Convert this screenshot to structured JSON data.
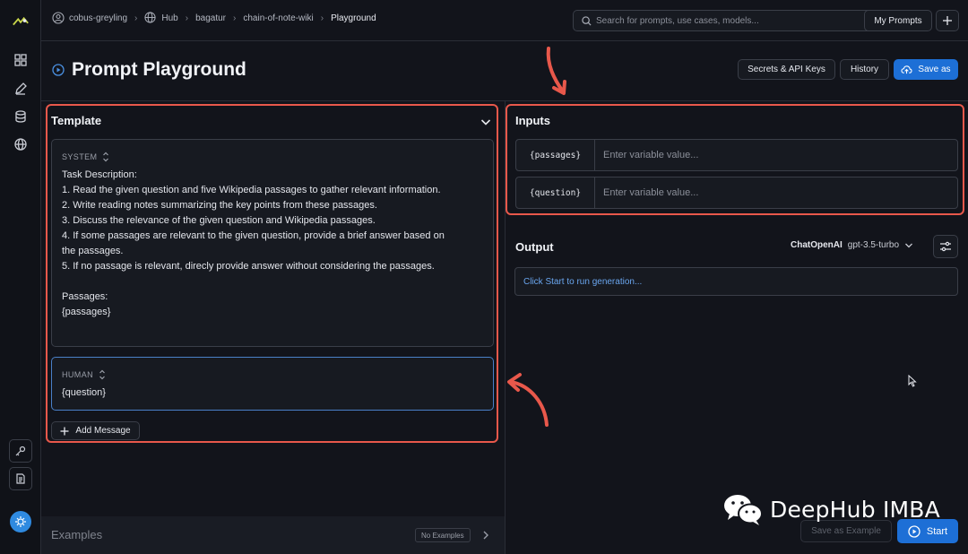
{
  "breadcrumbs": {
    "user": "cobus-greyling",
    "hub": "Hub",
    "owner": "bagatur",
    "repo": "chain-of-note-wiki",
    "current": "Playground"
  },
  "search": {
    "placeholder": "Search for prompts, use cases, models..."
  },
  "top_actions": {
    "my_prompts": "My Prompts"
  },
  "page": {
    "title": "Prompt Playground"
  },
  "header_actions": {
    "secrets": "Secrets & API Keys",
    "history": "History",
    "save_as": "Save as"
  },
  "template": {
    "title": "Template",
    "messages": [
      {
        "role": "SYSTEM",
        "text": "Task Description:\n1. Read the given question and five Wikipedia passages to gather relevant information.\n2. Write reading notes summarizing the key points from these passages.\n3. Discuss the relevance of the given question and Wikipedia passages.\n4. If some passages are relevant to the given question, provide a brief answer based on\nthe passages.\n5. If no passage is relevant, direcly provide answer without considering the passages.\n\nPassages:\n{passages}"
      },
      {
        "role": "HUMAN",
        "text": "{question}"
      }
    ],
    "add_message": "Add Message"
  },
  "inputs": {
    "title": "Inputs",
    "variables": [
      {
        "name": "{passages}",
        "placeholder": "Enter variable value..."
      },
      {
        "name": "{question}",
        "placeholder": "Enter variable value..."
      }
    ]
  },
  "output": {
    "title": "Output",
    "provider": "ChatOpenAI",
    "model": "gpt-3.5-turbo",
    "placeholder": "Click Start to run generation..."
  },
  "examples": {
    "title": "Examples",
    "badge": "No Examples"
  },
  "footer_actions": {
    "save_example": "Save as Example",
    "start": "Start"
  },
  "watermark": {
    "text": "DeepHub IMBA"
  },
  "colors": {
    "accent": "#1d6fd6",
    "highlight": "#e8584b",
    "background": "#12141b"
  }
}
